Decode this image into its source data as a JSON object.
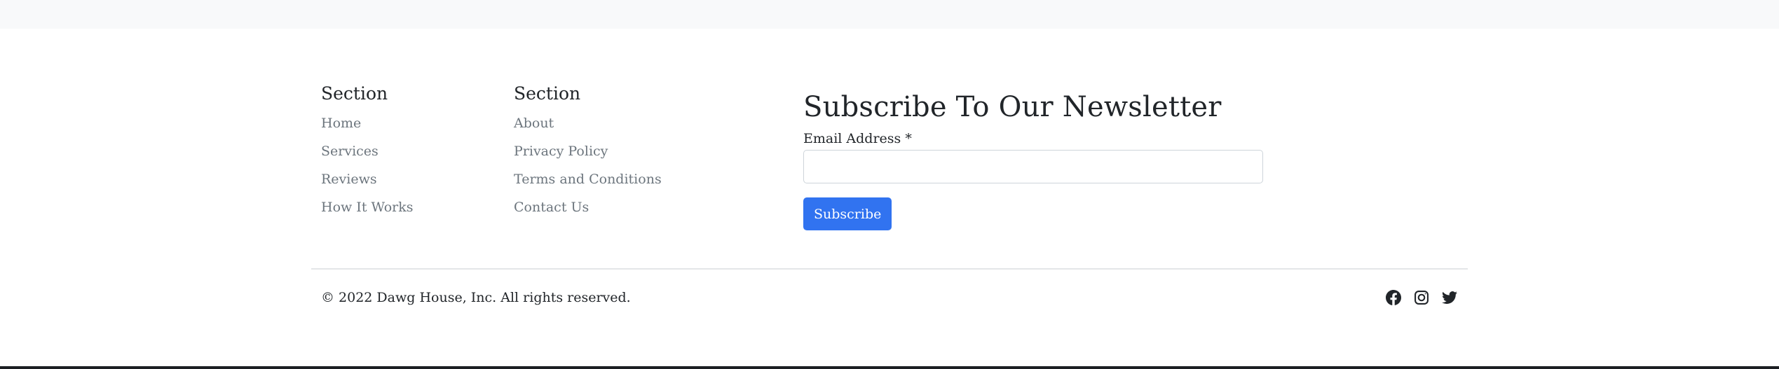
{
  "footer": {
    "sections": [
      {
        "heading": "Section",
        "links": [
          "Home",
          "Services",
          "Reviews",
          "How It Works"
        ]
      },
      {
        "heading": "Section",
        "links": [
          "About",
          "Privacy Policy",
          "Terms and Conditions",
          "Contact Us"
        ]
      }
    ],
    "newsletter": {
      "title": "Subscribe To Our Newsletter",
      "email_label": "Email Address *",
      "email_value": "",
      "button_label": "Subscribe"
    },
    "copyright": "© 2022 Dawg House, Inc. All rights reserved.",
    "social": [
      {
        "name": "facebook-icon"
      },
      {
        "name": "instagram-icon"
      },
      {
        "name": "twitter-icon"
      }
    ],
    "colors": {
      "accent": "#3173f0",
      "link": "#6c757d",
      "text": "#212529",
      "top_band": "#f8f9fa"
    }
  }
}
